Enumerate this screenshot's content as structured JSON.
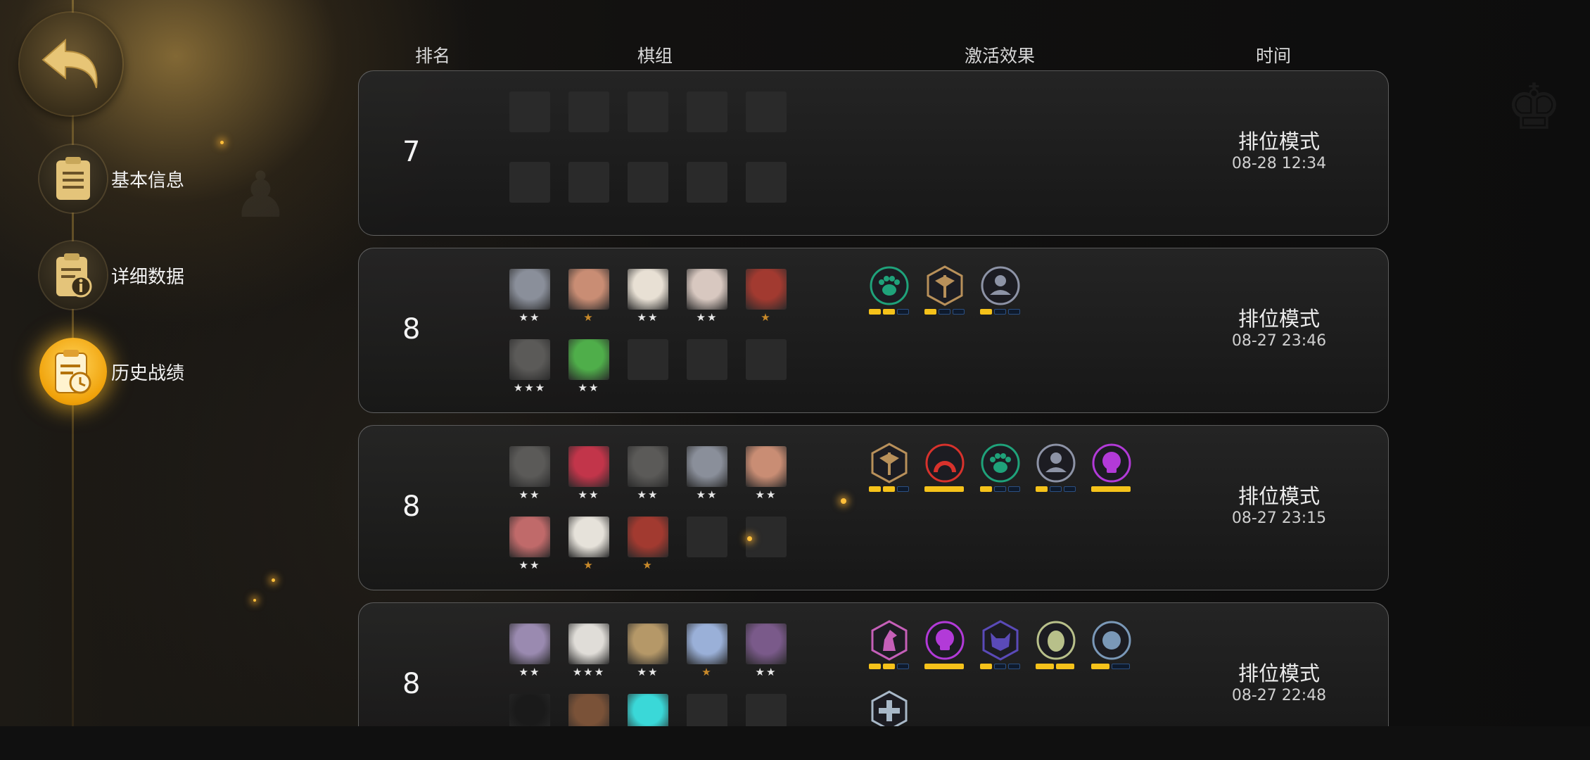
{
  "nav": {
    "back_icon": "back-arrow-icon",
    "items": [
      {
        "label": "基本信息",
        "icon": "clipboard-icon",
        "active": false
      },
      {
        "label": "详细数据",
        "icon": "info-document-icon",
        "active": false
      },
      {
        "label": "历史战绩",
        "icon": "history-clock-icon",
        "active": true
      }
    ]
  },
  "headers": {
    "rank": "排名",
    "lineup": "棋组",
    "synergy": "激活效果",
    "time": "时间"
  },
  "colors": {
    "gold": "#f5c21a",
    "pip_off": "#2b4f82",
    "silver_star": "#e8e8e8",
    "bronze_star": "#c98a2a"
  },
  "matches": [
    {
      "rank": "7",
      "mode": "排位模式",
      "time": "08-28 12:34",
      "pieces": [
        {},
        {},
        {},
        {},
        {},
        {},
        {},
        {},
        {},
        {}
      ],
      "synergies": []
    },
    {
      "rank": "8",
      "mode": "排位模式",
      "time": "08-27 23:46",
      "pieces": [
        {
          "stars": "★★",
          "color": "#8a8f9a"
        },
        {
          "stars": "★",
          "color": "#c98d74"
        },
        {
          "stars": "★★",
          "color": "#e8e0d4"
        },
        {
          "stars": "★★",
          "color": "#d8c8c0"
        },
        {
          "stars": "★",
          "color": "#a23a30"
        },
        {
          "stars": "★★★",
          "color": "#5b5a58"
        },
        {
          "stars": "★★",
          "color": "#4fae4a"
        },
        {},
        {},
        {}
      ],
      "synergies": [
        {
          "icon": "paw-icon",
          "color": "#1fa27a",
          "shape": "circle",
          "on": 2,
          "total": 3
        },
        {
          "icon": "axe-icon",
          "color": "#b8905a",
          "shape": "hex",
          "on": 1,
          "total": 3
        },
        {
          "icon": "person-icon",
          "color": "#8d93a6",
          "shape": "circle",
          "on": 1,
          "total": 3
        }
      ]
    },
    {
      "rank": "8",
      "mode": "排位模式",
      "time": "08-27 23:15",
      "pieces": [
        {
          "stars": "★★",
          "color": "#5b5a58"
        },
        {
          "stars": "★★",
          "color": "#c2354a"
        },
        {
          "stars": "★★",
          "color": "#5b5a58"
        },
        {
          "stars": "★★",
          "color": "#8a8f9a"
        },
        {
          "stars": "★★",
          "color": "#c98d74"
        },
        {
          "stars": "★★",
          "color": "#c06a6a"
        },
        {
          "stars": "★",
          "color": "#e6e2da"
        },
        {
          "stars": "★",
          "color": "#a23a30"
        },
        {},
        {}
      ],
      "synergies": [
        {
          "icon": "axe-icon",
          "color": "#b8905a",
          "shape": "hex",
          "on": 2,
          "total": 3
        },
        {
          "icon": "arch-icon",
          "color": "#d8322c",
          "shape": "circle",
          "on": 1,
          "total": 1
        },
        {
          "icon": "paw-icon",
          "color": "#1fa27a",
          "shape": "circle",
          "on": 1,
          "total": 3
        },
        {
          "icon": "person-icon",
          "color": "#8d93a6",
          "shape": "circle",
          "on": 1,
          "total": 3
        },
        {
          "icon": "skull-icon",
          "color": "#b23ad8",
          "shape": "circle",
          "on": 1,
          "total": 1
        }
      ]
    },
    {
      "rank": "8",
      "mode": "排位模式",
      "time": "08-27 22:48",
      "pieces": [
        {
          "stars": "★★",
          "color": "#9a8ab0"
        },
        {
          "stars": "★★★",
          "color": "#e0ddd8"
        },
        {
          "stars": "★★",
          "color": "#b59868"
        },
        {
          "stars": "★",
          "color": "#9ab0d8"
        },
        {
          "stars": "★★",
          "color": "#7a5a8a"
        },
        {
          "stars": "",
          "color": "#1a1a1a"
        },
        {
          "stars": "",
          "color": "#7a5238"
        },
        {
          "stars": "",
          "color": "#3ad8d8"
        },
        {},
        {}
      ],
      "synergies": [
        {
          "icon": "knight-icon",
          "color": "#c55fb8",
          "shape": "hex",
          "on": 2,
          "total": 3
        },
        {
          "icon": "skull-icon",
          "color": "#b23ad8",
          "shape": "circle",
          "on": 1,
          "total": 1
        },
        {
          "icon": "demon-icon",
          "color": "#5a4ab8",
          "shape": "hex",
          "on": 1,
          "total": 3
        },
        {
          "icon": "egg-icon",
          "color": "#b8c08a",
          "shape": "circle",
          "on": 2,
          "total": 2
        },
        {
          "icon": "orb-icon",
          "color": "#7a98b8",
          "shape": "circle",
          "on": 1,
          "total": 2
        },
        {
          "icon": "cross-icon",
          "color": "#a8b8c8",
          "shape": "hex",
          "on": 0,
          "total": 0
        }
      ]
    }
  ]
}
